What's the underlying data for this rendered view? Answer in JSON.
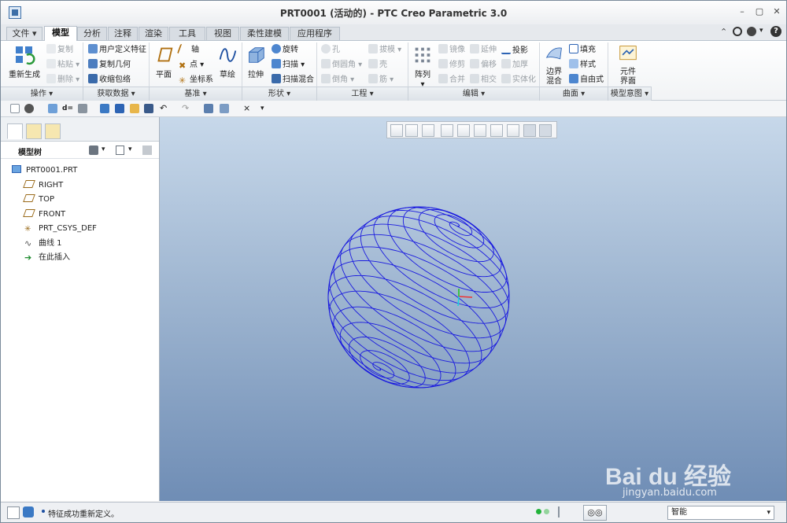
{
  "window": {
    "title": "PRT0001 (活动的) - PTC Creo Parametric 3.0"
  },
  "tabs": [
    {
      "label": "文件"
    },
    {
      "label": "模型"
    },
    {
      "label": "分析"
    },
    {
      "label": "注释"
    },
    {
      "label": "渲染"
    },
    {
      "label": "工具"
    },
    {
      "label": "视图"
    },
    {
      "label": "柔性建模"
    },
    {
      "label": "应用程序"
    }
  ],
  "ribbon": {
    "operations": {
      "regen": "重新生成",
      "copy": "复制",
      "paste": "粘贴",
      "delete": "删除",
      "group": "操作"
    },
    "getdata": {
      "udf": "用户定义特征",
      "copygeom": "复制几何",
      "shrinkwrap": "收缩包络",
      "group": "获取数据"
    },
    "datum": {
      "plane": "平面",
      "axis": "轴",
      "point": "点",
      "csys": "坐标系",
      "sketch": "草绘",
      "group": "基准"
    },
    "shape": {
      "extrude": "拉伸",
      "revolve": "旋转",
      "sweep": "扫描",
      "sweptblend": "扫描混合",
      "group": "形状"
    },
    "engineering": {
      "hole": "孔",
      "round": "倒圆角",
      "chamfer": "倒角",
      "draft": "拔模",
      "shell": "壳",
      "rib": "筋",
      "group": "工程"
    },
    "editing": {
      "pattern": "阵列",
      "mirror": "镜像",
      "trim": "修剪",
      "merge": "合并",
      "extend": "延伸",
      "offset": "偏移",
      "intersect": "相交",
      "project": "投影",
      "thicken": "加厚",
      "solidify": "实体化",
      "group": "编辑"
    },
    "surfaces": {
      "boundary1": "边界",
      "boundary2": "混合",
      "fill": "填充",
      "style": "样式",
      "freestyle": "自由式",
      "group": "曲面"
    },
    "intent": {
      "component1": "元件",
      "component2": "界面",
      "group": "模型意图"
    }
  },
  "model_tree": {
    "title": "模型树",
    "items": [
      {
        "label": "PRT0001.PRT"
      },
      {
        "label": "RIGHT"
      },
      {
        "label": "TOP"
      },
      {
        "label": "FRONT"
      },
      {
        "label": "PRT_CSYS_DEF"
      },
      {
        "label": "曲线 1"
      },
      {
        "label": "在此插入"
      }
    ]
  },
  "status": {
    "message": "特征成功重新定义。",
    "selection_filter": "智能"
  },
  "watermark": {
    "brand": "Bai du 经验",
    "url": "jingyan.baidu.com"
  },
  "colors": {
    "accent": "#2d64b4",
    "curve": "#1a1adf",
    "viewport_top": "#c7d8ea",
    "viewport_bottom": "#6f8db5"
  }
}
